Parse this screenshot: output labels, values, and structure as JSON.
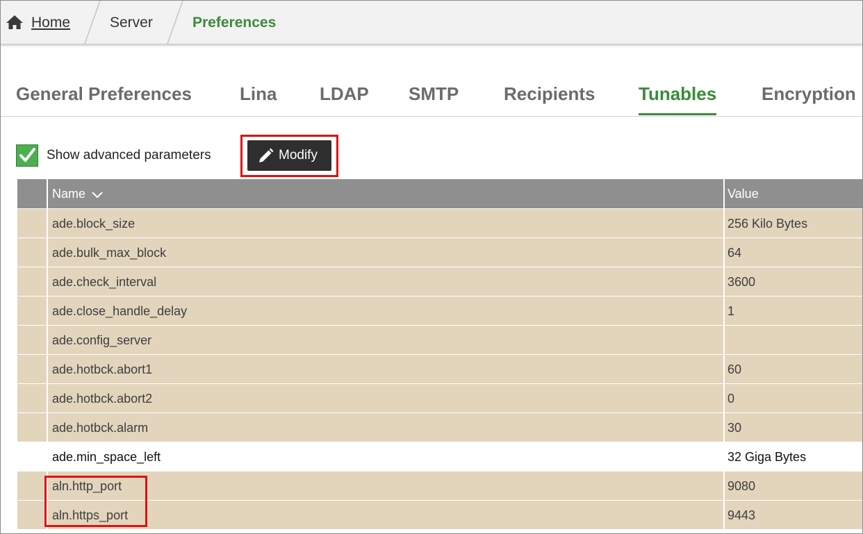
{
  "breadcrumb": {
    "home": "Home",
    "server": "Server",
    "current": "Preferences"
  },
  "tabs": [
    {
      "label": "General Preferences",
      "active": false
    },
    {
      "label": "Lina",
      "active": false
    },
    {
      "label": "LDAP",
      "active": false
    },
    {
      "label": "SMTP",
      "active": false
    },
    {
      "label": "Recipients",
      "active": false
    },
    {
      "label": "Tunables",
      "active": true
    },
    {
      "label": "Encryption",
      "active": false
    }
  ],
  "toolbar": {
    "show_advanced_label": "Show advanced parameters",
    "show_advanced_checked": true,
    "modify_label": "Modify"
  },
  "table": {
    "columns": {
      "name": "Name",
      "value": "Value"
    },
    "rows": [
      {
        "name": "ade.block_size",
        "value": "256 Kilo Bytes"
      },
      {
        "name": "ade.bulk_max_block",
        "value": "64"
      },
      {
        "name": "ade.check_interval",
        "value": "3600"
      },
      {
        "name": "ade.close_handle_delay",
        "value": "1"
      },
      {
        "name": "ade.config_server",
        "value": ""
      },
      {
        "name": "ade.hotbck.abort1",
        "value": "60"
      },
      {
        "name": "ade.hotbck.abort2",
        "value": "0"
      },
      {
        "name": "ade.hotbck.alarm",
        "value": "30"
      },
      {
        "name": "ade.min_space_left",
        "value": "32 Giga Bytes"
      },
      {
        "name": "aln.http_port",
        "value": "9080"
      },
      {
        "name": "aln.https_port",
        "value": "9443"
      }
    ]
  },
  "colors": {
    "accent": "#3a8b3a",
    "row_tint": "#e2d5bc",
    "header": "#8f8f8f",
    "highlight": "#e01010"
  }
}
